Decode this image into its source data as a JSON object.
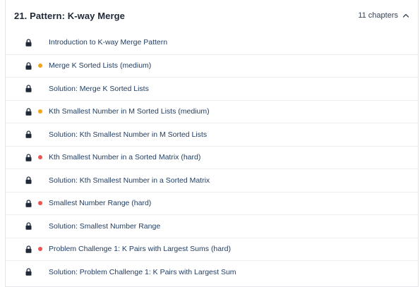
{
  "section": {
    "title": "21.  Pattern: K-way Merge",
    "chapters_label": "11 chapters"
  },
  "colors": {
    "medium": "#f2a516",
    "hard": "#ea5455"
  },
  "items": [
    {
      "label": "Introduction to K-way Merge Pattern",
      "difficulty": "none"
    },
    {
      "label": "Merge K Sorted Lists (medium)",
      "difficulty": "medium"
    },
    {
      "label": "Solution: Merge K Sorted Lists",
      "difficulty": "none"
    },
    {
      "label": "Kth Smallest Number in M Sorted Lists (medium)",
      "difficulty": "medium"
    },
    {
      "label": "Solution: Kth Smallest Number in M Sorted Lists",
      "difficulty": "none"
    },
    {
      "label": "Kth Smallest Number in a Sorted Matrix (hard)",
      "difficulty": "hard"
    },
    {
      "label": "Solution: Kth Smallest Number in a Sorted Matrix",
      "difficulty": "none"
    },
    {
      "label": "Smallest Number Range (hard)",
      "difficulty": "hard"
    },
    {
      "label": "Solution: Smallest Number Range",
      "difficulty": "none"
    },
    {
      "label": "Problem Challenge 1: K Pairs with Largest Sums (hard)",
      "difficulty": "hard"
    },
    {
      "label": "Solution: Problem Challenge 1: K Pairs with Largest Sum",
      "difficulty": "none"
    }
  ]
}
